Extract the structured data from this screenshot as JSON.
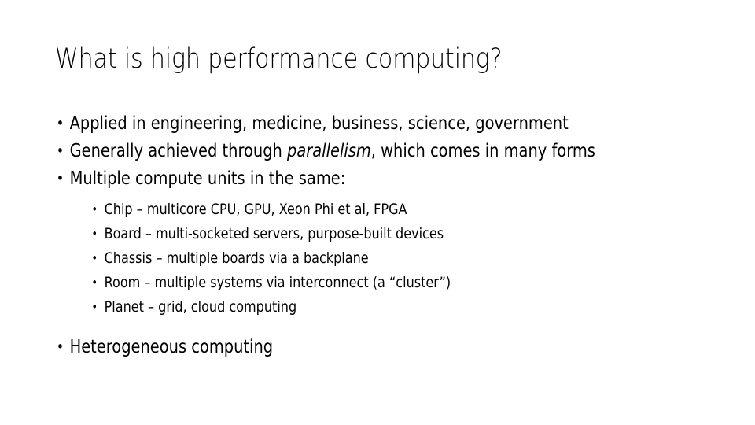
{
  "slide": {
    "title": "What is high performance computing?",
    "background_color": "#ffffff",
    "text_color": "#000000",
    "bullets": [
      {
        "level": 1,
        "text": "Applied in engineering, medicine, business, science, government"
      },
      {
        "level": 1,
        "text_before_italic": "Generally achieved through ",
        "italic_text": "parallelism",
        "text_after_italic": ", which comes in many forms"
      },
      {
        "level": 1,
        "text": "Multiple compute units in the same:"
      },
      {
        "level": 1,
        "text": "Heterogeneous computing"
      }
    ],
    "sub_bullets": [
      {
        "level": 2,
        "text": "Chip – multicore CPU, GPU, Xeon Phi et al, FPGA"
      },
      {
        "level": 2,
        "text": "Board – multi-socketed servers, purpose-built devices"
      },
      {
        "level": 2,
        "text": "Chassis – multiple boards via a backplane"
      },
      {
        "level": 2,
        "text": "Room – multiple systems via interconnect (a “cluster”)"
      },
      {
        "level": 2,
        "text": "Planet – grid, cloud computing"
      }
    ]
  }
}
